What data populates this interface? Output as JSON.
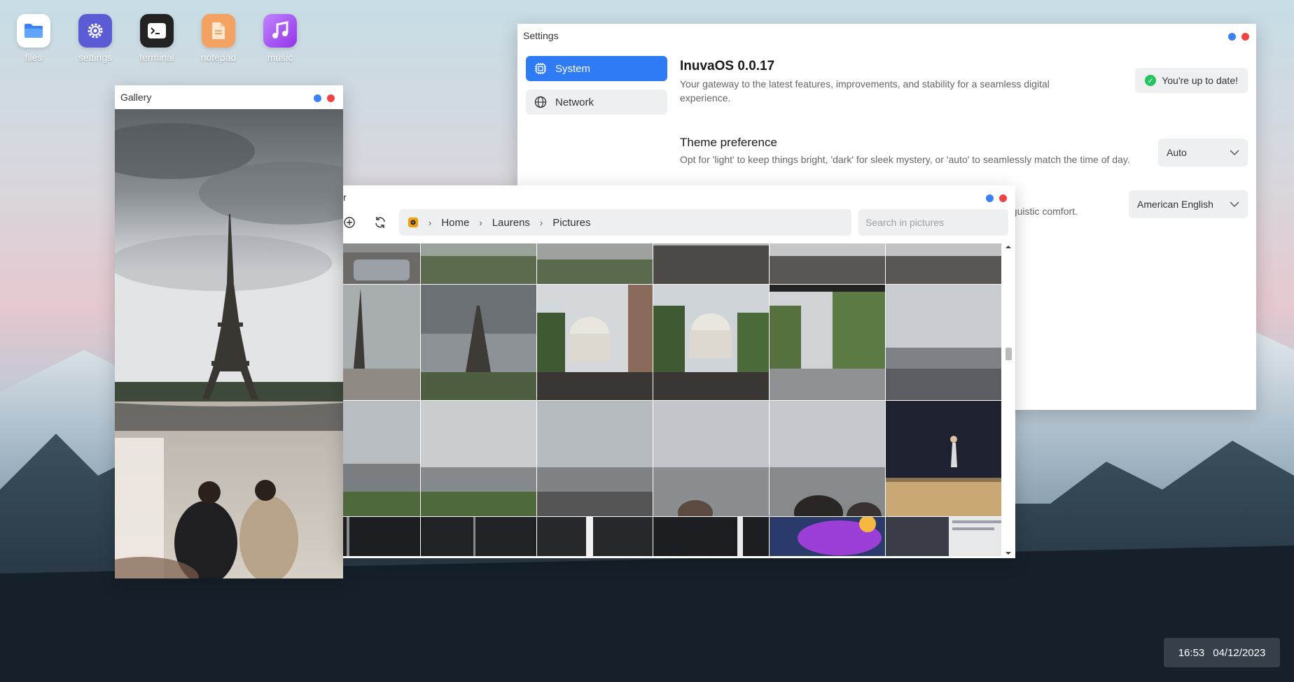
{
  "desktop": {
    "icons": [
      {
        "label": "files",
        "color": "#ffffff"
      },
      {
        "label": "settings",
        "color": "#5b5bd6"
      },
      {
        "label": "terminal",
        "color": "#222222"
      },
      {
        "label": "notepad",
        "color": "#f4a261"
      },
      {
        "label": "music",
        "color": "#a855f7"
      }
    ]
  },
  "settings_window": {
    "title": "Settings",
    "sidebar": [
      {
        "label": "System",
        "icon": "cpu-icon",
        "active": true
      },
      {
        "label": "Network",
        "icon": "globe-icon",
        "active": false
      }
    ],
    "os": {
      "name": "InuvaOS 0.0.17",
      "description": "Your gateway to the latest features, improvements, and stability for a seamless digital experience.",
      "status": "You're up to date!"
    },
    "theme": {
      "label": "Theme preference",
      "description": "Opt for 'light' to keep things bright, 'dark' for sleek mystery, or 'auto' to seamlessly match the time of day.",
      "value": "Auto"
    },
    "language": {
      "description_visible": "nguistic comfort.",
      "value": "American English"
    }
  },
  "gallery_window": {
    "title": "Gallery"
  },
  "explorer_window": {
    "title_visible": "r",
    "breadcrumbs": [
      "Home",
      "Laurens",
      "Pictures"
    ],
    "search_placeholder": "Search in pictures"
  },
  "clock": {
    "time": "16:53",
    "date": "04/12/2023"
  },
  "colors": {
    "accent": "#2f7bf5",
    "success": "#22c55e",
    "close": "#ef4444",
    "minimize": "#3b82f6"
  }
}
